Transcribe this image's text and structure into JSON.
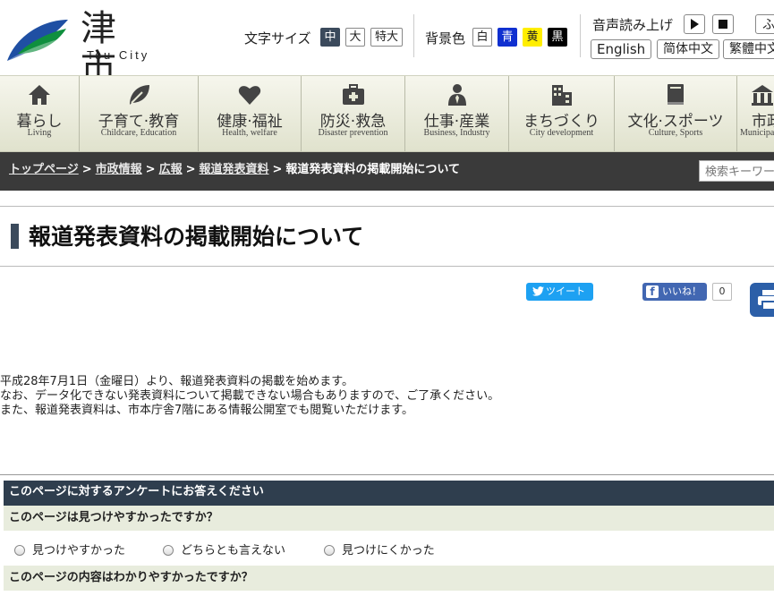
{
  "header": {
    "logo_kanji": "津市",
    "logo_roman": "Tsu City",
    "font_size_label": "文字サイズ",
    "font_sizes": [
      "中",
      "大",
      "特大"
    ],
    "bg_label": "背景色",
    "bg_colors": [
      {
        "label": "白",
        "bg": "#ffffff",
        "fg": "#222222"
      },
      {
        "label": "青",
        "bg": "#1030d0",
        "fg": "#ffffff"
      },
      {
        "label": "黄",
        "bg": "#ffee00",
        "fg": "#222222"
      },
      {
        "label": "黒",
        "bg": "#000000",
        "fg": "#ffffff"
      }
    ],
    "read_aloud_label": "音声読み上げ",
    "languages": [
      "English",
      "简体中文",
      "繁體中文",
      "ふ"
    ]
  },
  "nav": [
    {
      "jp": "暮らし",
      "en": "Living",
      "icon": "house-icon"
    },
    {
      "jp": "子育て·教育",
      "en": "Childcare, Education",
      "icon": "leaf-icon"
    },
    {
      "jp": "健康·福祉",
      "en": "Health, welfare",
      "icon": "heart-icon"
    },
    {
      "jp": "防災·救急",
      "en": "Disaster prevention",
      "icon": "first-aid-kit-icon"
    },
    {
      "jp": "仕事·産業",
      "en": "Business, Industry",
      "icon": "businessperson-icon"
    },
    {
      "jp": "まちづくり",
      "en": "City development",
      "icon": "buildings-icon"
    },
    {
      "jp": "文化·スポーツ",
      "en": "Culture, Sports",
      "icon": "book-icon"
    },
    {
      "jp": "市政",
      "en": "Municipal",
      "icon": "city-hall-icon"
    }
  ],
  "breadcrumb": {
    "links": [
      "トップページ",
      "市政情報",
      "広報",
      "報道発表資料"
    ],
    "current": "報道発表資料の掲載開始について",
    "separator": ">"
  },
  "search": {
    "placeholder": "検索キーワード"
  },
  "page_title": "報道発表資料の掲載開始について",
  "social": {
    "tweet_label": "ツイート",
    "like_label": "いいね！",
    "like_count": "0"
  },
  "body": [
    "平成28年7月1日（金曜日）より、報道発表資料の掲載を始めます。",
    "なお、データ化できない発表資料について掲載できない場合もありますので、ご了承ください。",
    "また、報道発表資料は、市本庁舎7階にある情報公開室でも閲覧いただけます。"
  ],
  "survey": {
    "heading": "このページに対するアンケートにお答えください",
    "q1": "このページは見つけやすかったですか？",
    "q1_options": [
      "見つけやすかった",
      "どちらとも言えない",
      "見つけにくかった"
    ],
    "q2": "このページの内容はわかりやすかったですか？"
  }
}
